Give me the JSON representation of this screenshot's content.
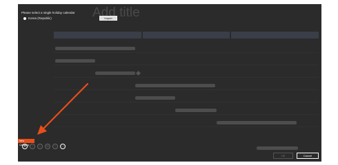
{
  "dialog": {
    "prompt": "Please select a single holiday calendar",
    "calendar_option": "Korea (Republic)",
    "import_label": "Import"
  },
  "chart": {
    "title": "Add title",
    "column_headers": [
      "",
      "",
      ""
    ],
    "row_labels": [
      "",
      "",
      "",
      "",
      "",
      "",
      ""
    ],
    "task_note": "",
    "date_marker": ""
  },
  "toolbar": {
    "tooltip": "New Category",
    "buttons": [
      {
        "icon": "add-icon",
        "glyph": "+"
      },
      {
        "icon": "indent-icon",
        "glyph": "›"
      },
      {
        "icon": "outdent-icon",
        "glyph": "‹"
      },
      {
        "icon": "link-icon",
        "glyph": "∞"
      },
      {
        "icon": "move-icon",
        "glyph": "↕"
      },
      {
        "icon": "more-icon",
        "glyph": "⋯"
      }
    ]
  },
  "footer": {
    "ok_label": "OK",
    "cancel_label": "Cancel"
  },
  "colors": {
    "overlay": "#2b2b2b",
    "accent": "#e84e1a"
  }
}
